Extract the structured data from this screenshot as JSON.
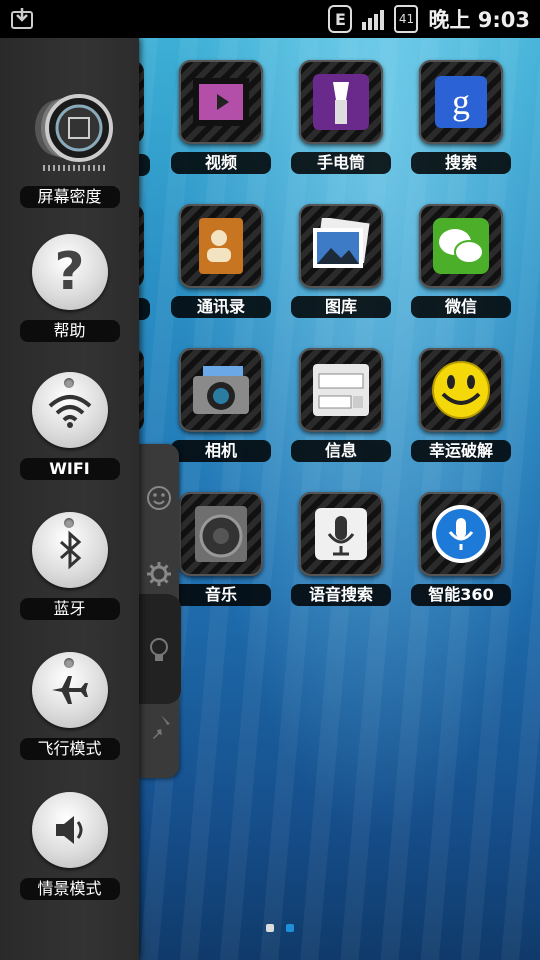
{
  "status_bar": {
    "network": "E",
    "battery": "41",
    "time": "晚上 9:03"
  },
  "apps": [
    {
      "label": "视频",
      "icon": "video-icon"
    },
    {
      "label": "手电筒",
      "icon": "flashlight-icon"
    },
    {
      "label": "搜索",
      "icon": "google-search-icon"
    },
    {
      "label": "通讯录",
      "icon": "contacts-icon"
    },
    {
      "label": "图库",
      "icon": "gallery-icon"
    },
    {
      "label": "微信",
      "icon": "wechat-icon"
    },
    {
      "label": "相机",
      "icon": "camera-icon"
    },
    {
      "label": "信息",
      "icon": "messaging-icon"
    },
    {
      "label": "幸运破解",
      "icon": "smiley-icon"
    },
    {
      "label": "音乐",
      "icon": "speaker-icon"
    },
    {
      "label": "语音搜索",
      "icon": "microphone-icon"
    },
    {
      "label": "智能360",
      "icon": "voice-assistant-icon"
    }
  ],
  "drawer": {
    "items": [
      {
        "label": "屏幕密度",
        "icon": "screen-density-icon"
      },
      {
        "label": "帮助",
        "icon": "help-icon"
      },
      {
        "label": "WIFI",
        "icon": "wifi-icon"
      },
      {
        "label": "蓝牙",
        "icon": "bluetooth-icon"
      },
      {
        "label": "飞行模式",
        "icon": "airplane-icon"
      },
      {
        "label": "情景模式",
        "icon": "volume-icon"
      }
    ]
  },
  "side_tabs": [
    "smiley-tab-icon",
    "gear-tab-icon",
    "bulb-tab-icon",
    "pin-tab-icon"
  ],
  "page_indicator": {
    "pages": 2,
    "current": 2
  },
  "colors": {
    "drawer_bg": "#333333",
    "label_bg": "#0c0c0c",
    "dot_active": "#1e90d8",
    "dot_inactive": "#dddddd"
  }
}
